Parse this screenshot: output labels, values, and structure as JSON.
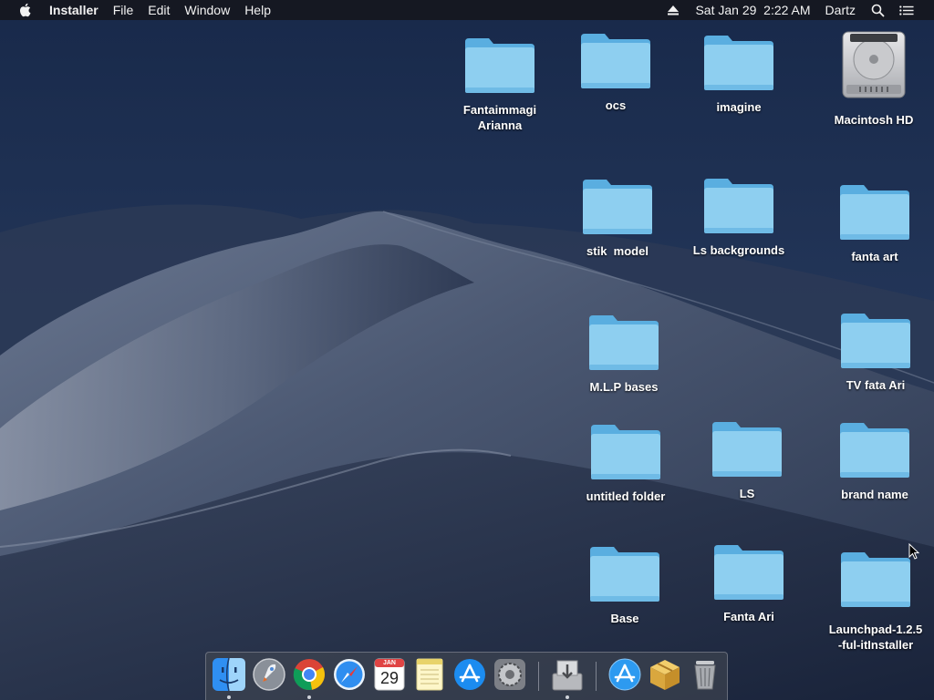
{
  "menubar": {
    "apple_icon": "apple-logo-icon",
    "app_name": "Installer",
    "items": [
      "File",
      "Edit",
      "Window",
      "Help"
    ],
    "status": {
      "eject_icon": "eject-icon",
      "datetime": "Sat Jan 29  2:22 AM",
      "user": "Dartz",
      "search_icon": "spotlight-search-icon",
      "notification_icon": "notification-center-icon"
    }
  },
  "desktop": {
    "icons": [
      {
        "label": "Fantaimmagi\nArianna",
        "type": "folder"
      },
      {
        "label": "ocs",
        "type": "folder"
      },
      {
        "label": "imagine",
        "type": "folder"
      },
      {
        "label": "Macintosh HD",
        "type": "hard-drive"
      },
      {
        "label": "stik  model",
        "type": "folder"
      },
      {
        "label": "Ls backgrounds",
        "type": "folder"
      },
      {
        "label": "fanta art",
        "type": "folder"
      },
      {
        "label": "M.L.P bases",
        "type": "folder"
      },
      {
        "label": "TV fata Ari",
        "type": "folder"
      },
      {
        "label": "untitled folder",
        "type": "folder"
      },
      {
        "label": "LS",
        "type": "folder"
      },
      {
        "label": "brand name",
        "type": "folder"
      },
      {
        "label": "Base",
        "type": "folder"
      },
      {
        "label": "Fanta Ari",
        "type": "folder"
      },
      {
        "label": "Launchpad-1.2.5\n-ful-itInstaller",
        "type": "folder"
      }
    ]
  },
  "dock": {
    "apps": [
      {
        "name": "finder-icon",
        "running": true
      },
      {
        "name": "launchpad-icon",
        "running": false
      },
      {
        "name": "chrome-icon",
        "running": true
      },
      {
        "name": "safari-icon",
        "running": false
      },
      {
        "name": "calendar-icon",
        "running": false,
        "month": "JAN",
        "day": "29"
      },
      {
        "name": "notes-icon",
        "running": false
      },
      {
        "name": "app-store-icon",
        "running": false
      },
      {
        "name": "system-preferences-icon",
        "running": false
      },
      {
        "name": "installer-icon",
        "running": true
      },
      {
        "name": "app-store-download-icon",
        "running": false
      },
      {
        "name": "package-icon",
        "running": false
      },
      {
        "name": "trash-icon",
        "running": false
      }
    ]
  },
  "colors": {
    "folder_light": "#8ecff0",
    "folder_dark": "#5aaee0",
    "menubar": "#16181e",
    "sky_top": "#1a2d4d",
    "dune": "#4a5870"
  }
}
